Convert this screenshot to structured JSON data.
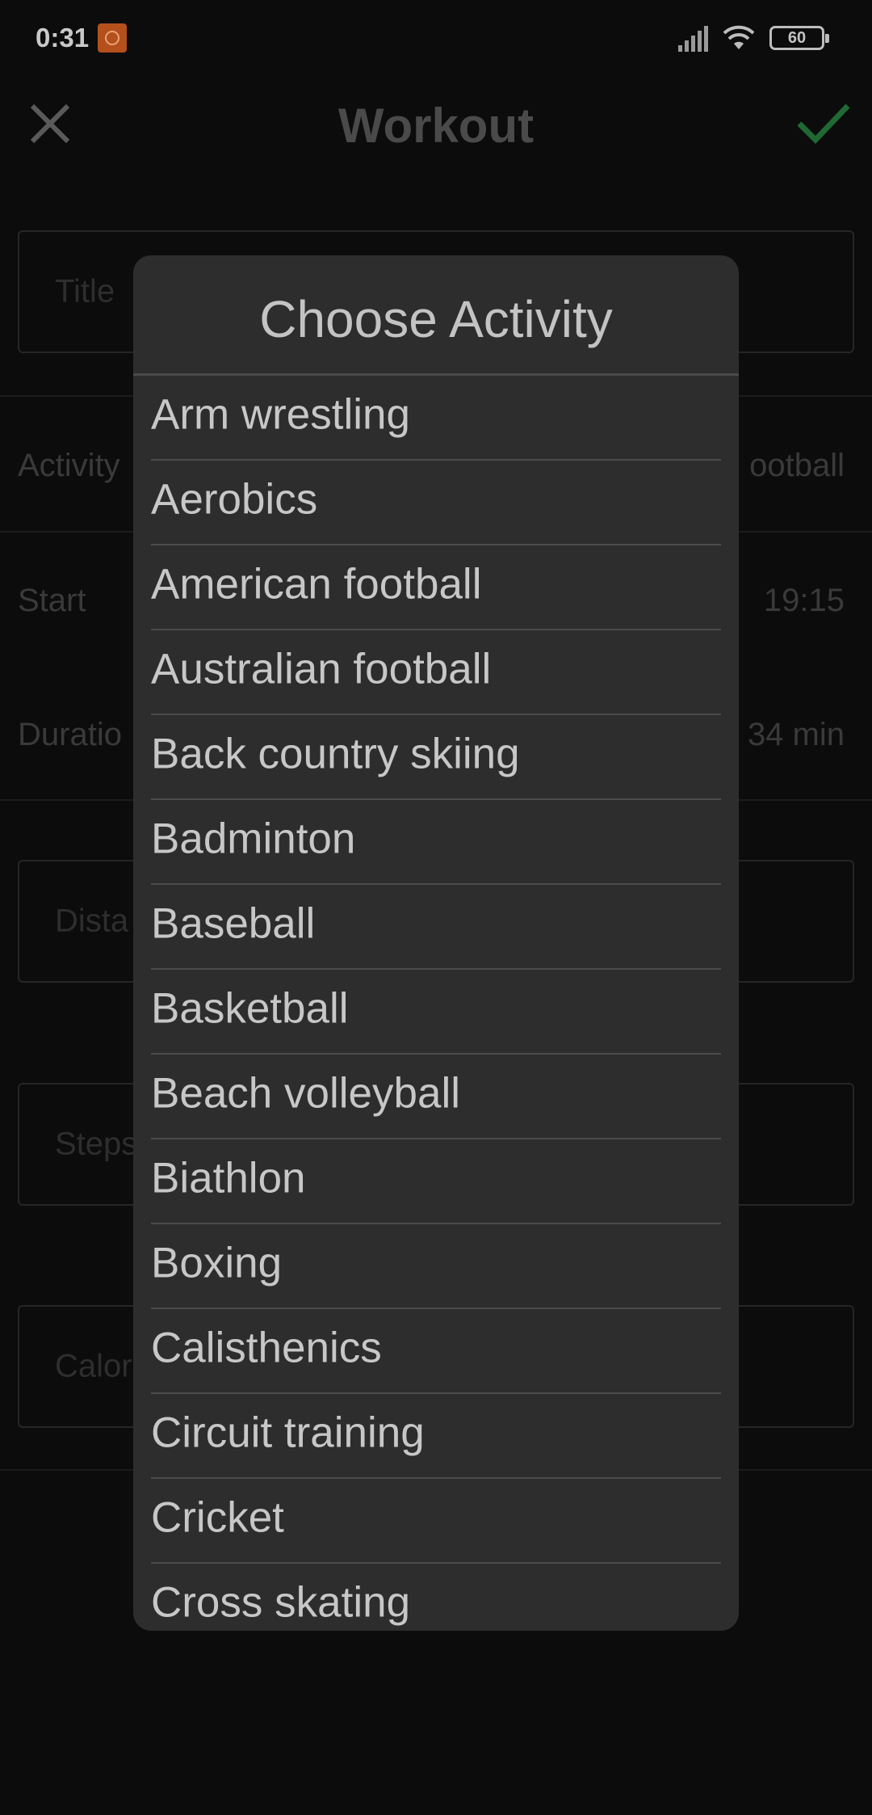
{
  "status_bar": {
    "time": "0:31",
    "battery": "60"
  },
  "app_bar": {
    "title": "Workout",
    "close_icon": "close-icon",
    "confirm_icon": "check-icon",
    "confirm_color": "#1f7a3a"
  },
  "form": {
    "title_placeholder": "Title",
    "activity_label": "Activity",
    "activity_value": "ootball",
    "start_label": "Start",
    "start_value": "19:15",
    "duration_label": "Duratio",
    "duration_value": "34 min",
    "distance_placeholder": "Dista",
    "steps_placeholder": "Steps",
    "calories_placeholder": "Calor"
  },
  "dialog": {
    "title": "Choose Activity",
    "items": [
      "Arm wrestling",
      "Aerobics",
      "American football",
      "Australian football",
      "Back country skiing",
      "Badminton",
      "Baseball",
      "Basketball",
      "Beach volleyball",
      "Biathlon",
      "Boxing",
      "Calisthenics",
      "Circuit training",
      "Cricket",
      "Cross skating"
    ]
  }
}
